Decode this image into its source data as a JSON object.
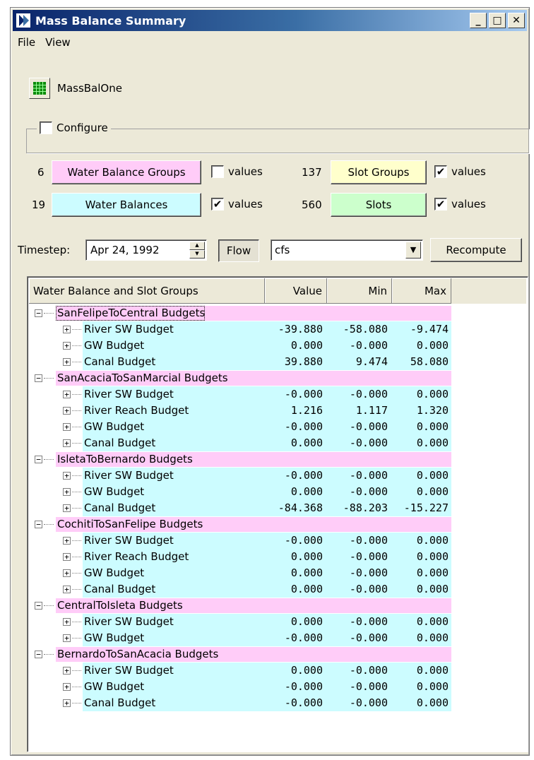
{
  "window": {
    "title": "Mass Balance Summary"
  },
  "menu": [
    "File",
    "View"
  ],
  "model": {
    "name": "MassBalOne"
  },
  "configure": {
    "label": "Configure",
    "checked": false
  },
  "counts": {
    "water_balance_groups": {
      "count": "6",
      "label": "Water Balance Groups",
      "values_label": "values",
      "values_checked": false,
      "color": "#ffccf8"
    },
    "slot_groups": {
      "count": "137",
      "label": "Slot Groups",
      "values_label": "values",
      "values_checked": true,
      "color": "#ffffcc"
    },
    "water_balances": {
      "count": "19",
      "label": "Water Balances",
      "values_label": "values",
      "values_checked": true,
      "color": "#ccfcff"
    },
    "slots": {
      "count": "560",
      "label": "Slots",
      "values_label": "values",
      "values_checked": true,
      "color": "#ccffcc"
    }
  },
  "timestep": {
    "label": "Timestep:",
    "value": "Apr 24, 1992"
  },
  "flow_button": "Flow",
  "unit": "cfs",
  "recompute": "Recompute",
  "tree": {
    "columns": [
      "Water Balance and Slot Groups",
      "Value",
      "Min",
      "Max"
    ],
    "groups": [
      {
        "name": "SanFelipeToCentral Budgets",
        "items": [
          {
            "name": "River SW Budget",
            "value": "-39.880",
            "min": "-58.080",
            "max": "-9.474"
          },
          {
            "name": "GW Budget",
            "value": "0.000",
            "min": "-0.000",
            "max": "0.000"
          },
          {
            "name": "Canal Budget",
            "value": "39.880",
            "min": "9.474",
            "max": "58.080"
          }
        ]
      },
      {
        "name": "SanAcaciaToSanMarcial Budgets",
        "items": [
          {
            "name": "River SW Budget",
            "value": "-0.000",
            "min": "-0.000",
            "max": "0.000"
          },
          {
            "name": "River Reach Budget",
            "value": "1.216",
            "min": "1.117",
            "max": "1.320"
          },
          {
            "name": "GW Budget",
            "value": "-0.000",
            "min": "-0.000",
            "max": "0.000"
          },
          {
            "name": "Canal Budget",
            "value": "0.000",
            "min": "-0.000",
            "max": "0.000"
          }
        ]
      },
      {
        "name": "IsletaToBernardo Budgets",
        "items": [
          {
            "name": "River SW Budget",
            "value": "-0.000",
            "min": "-0.000",
            "max": "0.000"
          },
          {
            "name": "GW Budget",
            "value": "0.000",
            "min": "-0.000",
            "max": "0.000"
          },
          {
            "name": "Canal Budget",
            "value": "-84.368",
            "min": "-88.203",
            "max": "-15.227"
          }
        ]
      },
      {
        "name": "CochitiToSanFelipe Budgets",
        "items": [
          {
            "name": "River SW Budget",
            "value": "-0.000",
            "min": "-0.000",
            "max": "0.000"
          },
          {
            "name": "River Reach Budget",
            "value": "0.000",
            "min": "-0.000",
            "max": "0.000"
          },
          {
            "name": "GW Budget",
            "value": "0.000",
            "min": "-0.000",
            "max": "0.000"
          },
          {
            "name": "Canal Budget",
            "value": "0.000",
            "min": "-0.000",
            "max": "0.000"
          }
        ]
      },
      {
        "name": "CentralToIsleta Budgets",
        "items": [
          {
            "name": "River SW Budget",
            "value": "0.000",
            "min": "-0.000",
            "max": "0.000"
          },
          {
            "name": "GW Budget",
            "value": "-0.000",
            "min": "-0.000",
            "max": "0.000"
          }
        ]
      },
      {
        "name": "BernardoToSanAcacia Budgets",
        "items": [
          {
            "name": "River SW Budget",
            "value": "0.000",
            "min": "-0.000",
            "max": "0.000"
          },
          {
            "name": "GW Budget",
            "value": "-0.000",
            "min": "-0.000",
            "max": "0.000"
          },
          {
            "name": "Canal Budget",
            "value": "-0.000",
            "min": "-0.000",
            "max": "0.000"
          }
        ]
      }
    ]
  }
}
